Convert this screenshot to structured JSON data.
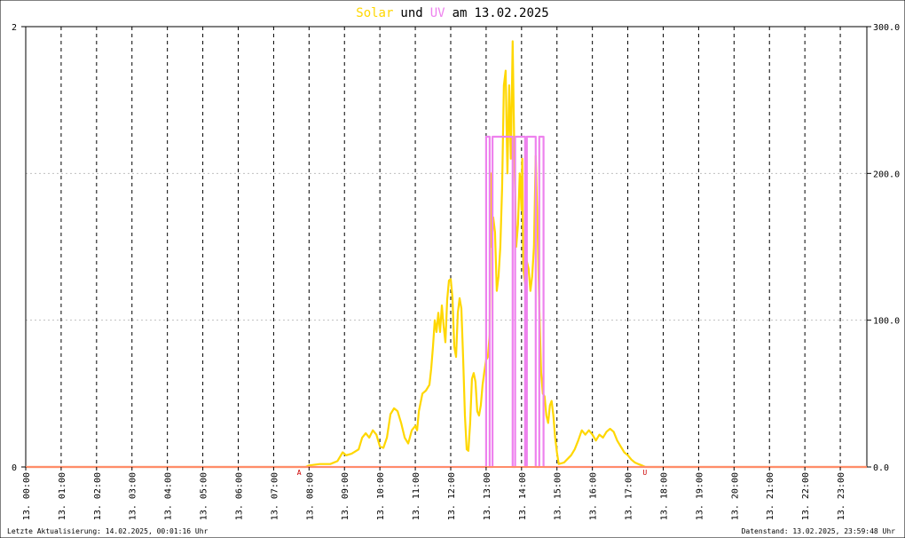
{
  "chart_data": {
    "type": "line",
    "title": {
      "solar_word": "Solar",
      "und_word": "und",
      "uv_word": "UV",
      "am_word": "am",
      "date": "13.02.2025"
    },
    "x_ticks": [
      "13. 00:00",
      "13. 01:00",
      "13. 02:00",
      "13. 03:00",
      "13. 04:00",
      "13. 05:00",
      "13. 06:00",
      "13. 07:00",
      "13. 08:00",
      "13. 09:00",
      "13. 10:00",
      "13. 11:00",
      "13. 12:00",
      "13. 13:00",
      "13. 14:00",
      "13. 15:00",
      "13. 16:00",
      "13. 17:00",
      "13. 18:00",
      "13. 19:00",
      "13. 20:00",
      "13. 21:00",
      "13. 22:00",
      "13. 23:00"
    ],
    "xlim_hours": [
      0,
      23.75
    ],
    "left_axis": {
      "ticks": [
        "0",
        "2"
      ],
      "ylim": [
        0,
        2
      ],
      "series": "UV"
    },
    "right_axis": {
      "ticks": [
        "0.0",
        "100.0",
        "200.0",
        "300.0"
      ],
      "ylim": [
        0,
        300
      ],
      "series": "Solar"
    },
    "grid": true,
    "sun_markers": [
      {
        "label": "A",
        "hour": 7.72,
        "color": "#cc0000"
      },
      {
        "label": "U",
        "hour": 17.48,
        "color": "#cc0000"
      }
    ],
    "series": [
      {
        "name": "Solar",
        "color": "#ffd700",
        "axis": "right",
        "points": [
          [
            0,
            0
          ],
          [
            7.9,
            0
          ],
          [
            8.0,
            1
          ],
          [
            8.3,
            2
          ],
          [
            8.6,
            2
          ],
          [
            8.8,
            4
          ],
          [
            8.95,
            10
          ],
          [
            9.05,
            8
          ],
          [
            9.2,
            9
          ],
          [
            9.4,
            12
          ],
          [
            9.5,
            20
          ],
          [
            9.6,
            23
          ],
          [
            9.7,
            20
          ],
          [
            9.8,
            25
          ],
          [
            9.9,
            22
          ],
          [
            10.0,
            14
          ],
          [
            10.1,
            13
          ],
          [
            10.2,
            20
          ],
          [
            10.3,
            36
          ],
          [
            10.4,
            40
          ],
          [
            10.5,
            38
          ],
          [
            10.6,
            30
          ],
          [
            10.7,
            20
          ],
          [
            10.8,
            16
          ],
          [
            10.9,
            25
          ],
          [
            11.0,
            28
          ],
          [
            11.05,
            25
          ],
          [
            11.1,
            38
          ],
          [
            11.2,
            50
          ],
          [
            11.3,
            52
          ],
          [
            11.4,
            56
          ],
          [
            11.45,
            67
          ],
          [
            11.5,
            82
          ],
          [
            11.55,
            100
          ],
          [
            11.6,
            92
          ],
          [
            11.65,
            105
          ],
          [
            11.7,
            92
          ],
          [
            11.75,
            110
          ],
          [
            11.8,
            96
          ],
          [
            11.85,
            85
          ],
          [
            11.9,
            114
          ],
          [
            11.95,
            127
          ],
          [
            12.0,
            128
          ],
          [
            12.05,
            115
          ],
          [
            12.1,
            82
          ],
          [
            12.15,
            75
          ],
          [
            12.2,
            105
          ],
          [
            12.25,
            115
          ],
          [
            12.3,
            108
          ],
          [
            12.35,
            74
          ],
          [
            12.4,
            35
          ],
          [
            12.45,
            12
          ],
          [
            12.5,
            11
          ],
          [
            12.55,
            30
          ],
          [
            12.6,
            60
          ],
          [
            12.65,
            64
          ],
          [
            12.7,
            58
          ],
          [
            12.75,
            38
          ],
          [
            12.8,
            35
          ],
          [
            12.85,
            42
          ],
          [
            12.9,
            56
          ],
          [
            12.95,
            65
          ],
          [
            13.0,
            73
          ],
          [
            13.05,
            75
          ],
          [
            13.1,
            90
          ],
          [
            13.13,
            200
          ],
          [
            13.15,
            150
          ],
          [
            13.2,
            170
          ],
          [
            13.25,
            160
          ],
          [
            13.3,
            120
          ],
          [
            13.35,
            130
          ],
          [
            13.4,
            150
          ],
          [
            13.45,
            190
          ],
          [
            13.5,
            260
          ],
          [
            13.55,
            270
          ],
          [
            13.6,
            200
          ],
          [
            13.65,
            260
          ],
          [
            13.7,
            210
          ],
          [
            13.75,
            290
          ],
          [
            13.8,
            210
          ],
          [
            13.85,
            150
          ],
          [
            13.9,
            165
          ],
          [
            13.95,
            200
          ],
          [
            14.0,
            175
          ],
          [
            14.02,
            210
          ],
          [
            14.05,
            135
          ],
          [
            14.1,
            125
          ],
          [
            14.15,
            140
          ],
          [
            14.2,
            135
          ],
          [
            14.25,
            120
          ],
          [
            14.3,
            130
          ],
          [
            14.35,
            150
          ],
          [
            14.4,
            212
          ],
          [
            14.45,
            165
          ],
          [
            14.5,
            110
          ],
          [
            14.55,
            65
          ],
          [
            14.6,
            50
          ],
          [
            14.65,
            48
          ],
          [
            14.7,
            35
          ],
          [
            14.75,
            30
          ],
          [
            14.8,
            42
          ],
          [
            14.85,
            45
          ],
          [
            14.9,
            35
          ],
          [
            14.95,
            20
          ],
          [
            15.0,
            10
          ],
          [
            15.05,
            2
          ],
          [
            15.2,
            3
          ],
          [
            15.4,
            8
          ],
          [
            15.5,
            12
          ],
          [
            15.6,
            18
          ],
          [
            15.7,
            25
          ],
          [
            15.8,
            22
          ],
          [
            15.9,
            25
          ],
          [
            16.0,
            22
          ],
          [
            16.1,
            18
          ],
          [
            16.2,
            22
          ],
          [
            16.3,
            20
          ],
          [
            16.4,
            24
          ],
          [
            16.5,
            26
          ],
          [
            16.6,
            24
          ],
          [
            16.7,
            18
          ],
          [
            16.8,
            14
          ],
          [
            16.9,
            10
          ],
          [
            17.0,
            8
          ],
          [
            17.1,
            5
          ],
          [
            17.2,
            3
          ],
          [
            17.3,
            2
          ],
          [
            17.4,
            1
          ],
          [
            17.5,
            0
          ],
          [
            23.75,
            0
          ]
        ]
      },
      {
        "name": "UV",
        "color": "#ee82ee",
        "axis": "left",
        "points": [
          [
            0,
            0
          ],
          [
            13.0,
            0
          ],
          [
            13.0,
            1.5
          ],
          [
            13.1,
            1.5
          ],
          [
            13.1,
            0
          ],
          [
            13.18,
            0
          ],
          [
            13.18,
            1.5
          ],
          [
            13.75,
            1.5
          ],
          [
            13.75,
            0
          ],
          [
            13.82,
            0
          ],
          [
            13.82,
            1.5
          ],
          [
            14.1,
            1.5
          ],
          [
            14.1,
            0
          ],
          [
            14.15,
            0
          ],
          [
            14.15,
            1.5
          ],
          [
            14.4,
            1.5
          ],
          [
            14.4,
            0
          ],
          [
            14.5,
            0
          ],
          [
            14.5,
            1.5
          ],
          [
            14.62,
            1.5
          ],
          [
            14.62,
            0
          ],
          [
            23.75,
            0
          ]
        ]
      },
      {
        "name": "baseline",
        "color": "#ff8c69",
        "axis": "left",
        "points": [
          [
            0,
            0
          ],
          [
            23.75,
            0
          ]
        ]
      }
    ]
  },
  "footer": {
    "left": "Letzte Aktualisierung: 14.02.2025, 00:01:16 Uhr",
    "right": "Datenstand: 13.02.2025, 23:59:48 Uhr"
  }
}
